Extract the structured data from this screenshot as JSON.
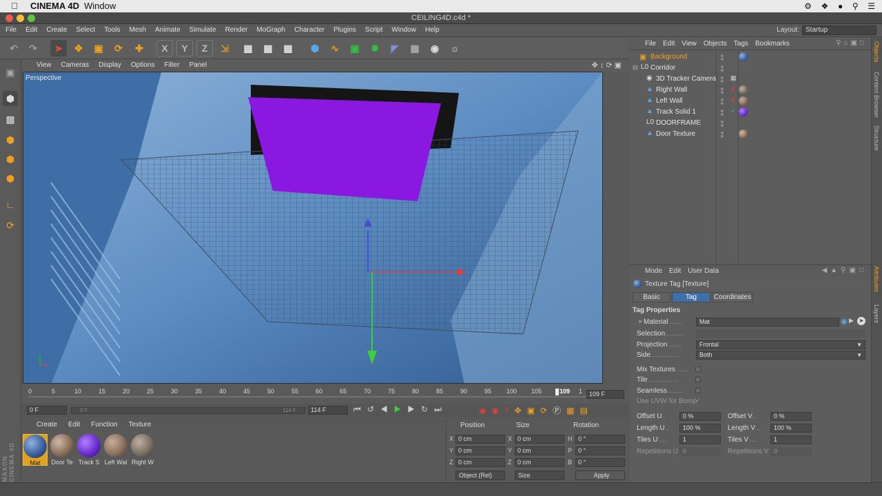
{
  "mac_menubar": {
    "apple": "",
    "app_name": "CINEMA 4D",
    "window_menu": "Window"
  },
  "title_bar": {
    "title": "CEILING4D.c4d *"
  },
  "app_menu": {
    "items": [
      "File",
      "Edit",
      "Create",
      "Select",
      "Tools",
      "Mesh",
      "Animate",
      "Simulate",
      "Render",
      "MoGraph",
      "Character",
      "Plugins",
      "Script",
      "Window",
      "Help"
    ],
    "layout_label": "Layout:",
    "layout_value": "Startup"
  },
  "viewport": {
    "menu": [
      "View",
      "Cameras",
      "Display",
      "Options",
      "Filter",
      "Panel"
    ],
    "label": "Perspective"
  },
  "timeline": {
    "ticks": [
      "0",
      "5",
      "10",
      "15",
      "20",
      "25",
      "30",
      "35",
      "40",
      "45",
      "50",
      "55",
      "60",
      "65",
      "70",
      "75",
      "80",
      "85",
      "90",
      "95",
      "100",
      "105",
      "109",
      "1"
    ],
    "current_frame_display": "109 F",
    "start_frame": "0 F",
    "range_start": "0 F",
    "range_end": "114 F",
    "end_frame": "114 F"
  },
  "materials": {
    "menu": [
      "Create",
      "Edit",
      "Function",
      "Texture"
    ],
    "items": [
      {
        "label": "Mat",
        "color": "#3a5f9e"
      },
      {
        "label": "Door Te",
        "color": "#8a6e5a"
      },
      {
        "label": "Track S",
        "color": "#6a2fd0"
      },
      {
        "label": "Left Wal",
        "color": "#8a7060"
      },
      {
        "label": "Right W",
        "color": "#7a6e62"
      }
    ]
  },
  "coordinates": {
    "headers": [
      "Position",
      "Size",
      "Rotation"
    ],
    "rows": [
      {
        "axis": "X",
        "pos": "0 cm",
        "size_axis": "X",
        "size": "0 cm",
        "rot_axis": "H",
        "rot": "0 °"
      },
      {
        "axis": "Y",
        "pos": "0 cm",
        "size_axis": "Y",
        "size": "0 cm",
        "rot_axis": "P",
        "rot": "0 °"
      },
      {
        "axis": "Z",
        "pos": "0 cm",
        "size_axis": "Z",
        "size": "0 cm",
        "rot_axis": "B",
        "rot": "0 °"
      }
    ],
    "mode_dropdown": "Object (Rel)",
    "size_dropdown": "Size",
    "apply_label": "Apply"
  },
  "object_manager": {
    "menu": [
      "File",
      "Edit",
      "View",
      "Objects",
      "Tags",
      "Bookmarks"
    ],
    "objects": [
      {
        "name": "Background",
        "indent": 0,
        "highlight": true,
        "tag_color": "#3a5f9e"
      },
      {
        "name": "Corridor",
        "indent": 0,
        "highlight": false,
        "tag_color": ""
      },
      {
        "name": "3D Tracker Camera",
        "indent": 1,
        "highlight": false,
        "tag_color": ""
      },
      {
        "name": "Right Wall",
        "indent": 1,
        "highlight": false,
        "tag_color": "#7a6e62"
      },
      {
        "name": "Left Wall",
        "indent": 1,
        "highlight": false,
        "tag_color": "#8a7060"
      },
      {
        "name": "Track Solid 1",
        "indent": 1,
        "highlight": false,
        "tag_color": "#6a2fd0"
      },
      {
        "name": "DOORFRAME",
        "indent": 1,
        "highlight": false,
        "tag_color": ""
      },
      {
        "name": "Door Texture",
        "indent": 1,
        "highlight": false,
        "tag_color": "#8a6e5a"
      }
    ]
  },
  "attributes": {
    "menu": [
      "Mode",
      "Edit",
      "User Data"
    ],
    "header": "Texture Tag [Texture]",
    "tabs": [
      "Basic",
      "Tag",
      "Coordinates"
    ],
    "active_tab": "Tag",
    "section": "Tag Properties",
    "material_label": "Material",
    "material_value": "Mat",
    "selection_label": "Selection",
    "projection_label": "Projection",
    "projection_value": "Frontal",
    "side_label": "Side",
    "side_value": "Both",
    "mix_label": "Mix Textures",
    "tile_label": "Tile",
    "seamless_label": "Seamless",
    "uvw_label": "Use UVW for Bump",
    "offset_u_label": "Offset U",
    "offset_u": "0 %",
    "offset_v_label": "Offset V",
    "offset_v": "0 %",
    "length_u_label": "Length U",
    "length_u": "100 %",
    "length_v_label": "Length V",
    "length_v": "100 %",
    "tiles_u_label": "Tiles U",
    "tiles_u": "1",
    "tiles_v_label": "Tiles V",
    "tiles_v": "1",
    "reps_u_label": "Repetitions U",
    "reps_u": "0",
    "reps_v_label": "Repetitions V",
    "reps_v": "0"
  },
  "right_tabs": [
    "Objects",
    "Content Browser",
    "Structure",
    "Attributes",
    "Layers"
  ],
  "brand": "MAXON CINEMA 4D"
}
